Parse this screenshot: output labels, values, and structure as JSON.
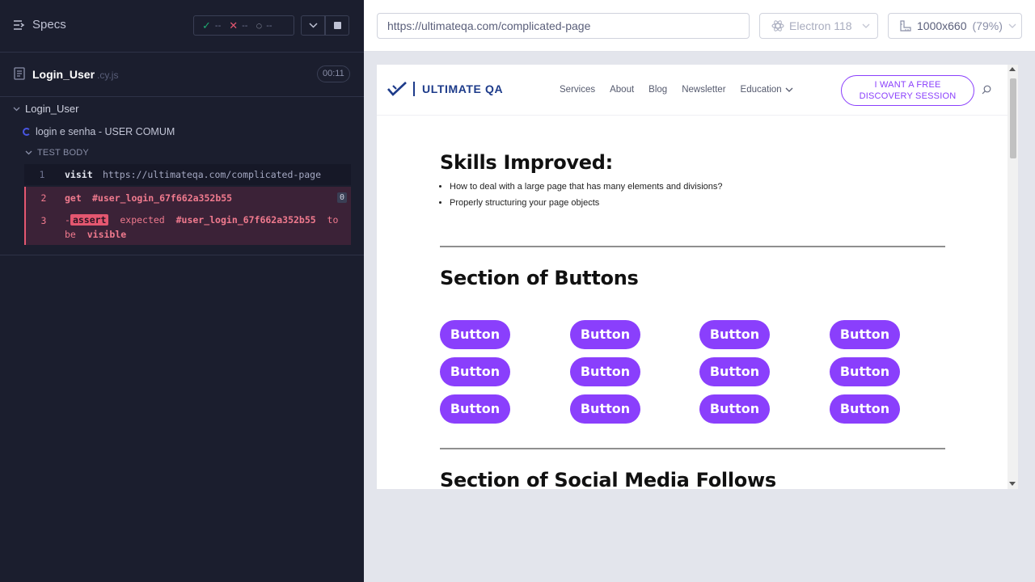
{
  "reporter": {
    "specs_label": "Specs",
    "stats": {
      "passed": "--",
      "failed": "--",
      "pending": "--"
    },
    "spec": {
      "name": "Login_User",
      "ext": ".cy.js",
      "duration": "00:11"
    },
    "suite": "Login_User",
    "test": "login e senha - USER COMUM",
    "body_label": "TEST BODY",
    "commands": [
      {
        "num": "1",
        "name": "visit",
        "message": "https://ultimateqa.com/complicated-page"
      },
      {
        "num": "2",
        "name": "get",
        "message": "#user_login_67f662a352b55",
        "badge": "0"
      },
      {
        "num": "3",
        "prefix": "-",
        "name": "assert",
        "expected": "expected",
        "selector": "#user_login_67f662a352b55",
        "to": "to",
        "be": "be",
        "visible": "visible"
      }
    ]
  },
  "topbar": {
    "url": "https://ultimateqa.com/complicated-page",
    "browser": "Electron 118",
    "viewport": "1000x660",
    "zoom": "(79%)"
  },
  "site": {
    "logo": "ULTIMATE QA",
    "nav": [
      "Services",
      "About",
      "Blog",
      "Newsletter",
      "Education"
    ],
    "cta_line1": "I WANT A FREE",
    "cta_line2": "DISCOVERY SESSION",
    "skills_title": "Skills Improved:",
    "skills": [
      "How to deal with a large page that has many elements and divisions?",
      "Properly structuring your page objects"
    ],
    "buttons_title": "Section of Buttons",
    "button_label": "Button",
    "social_title": "Section of Social Media Follows",
    "accent_color": "#8a3ffc"
  }
}
